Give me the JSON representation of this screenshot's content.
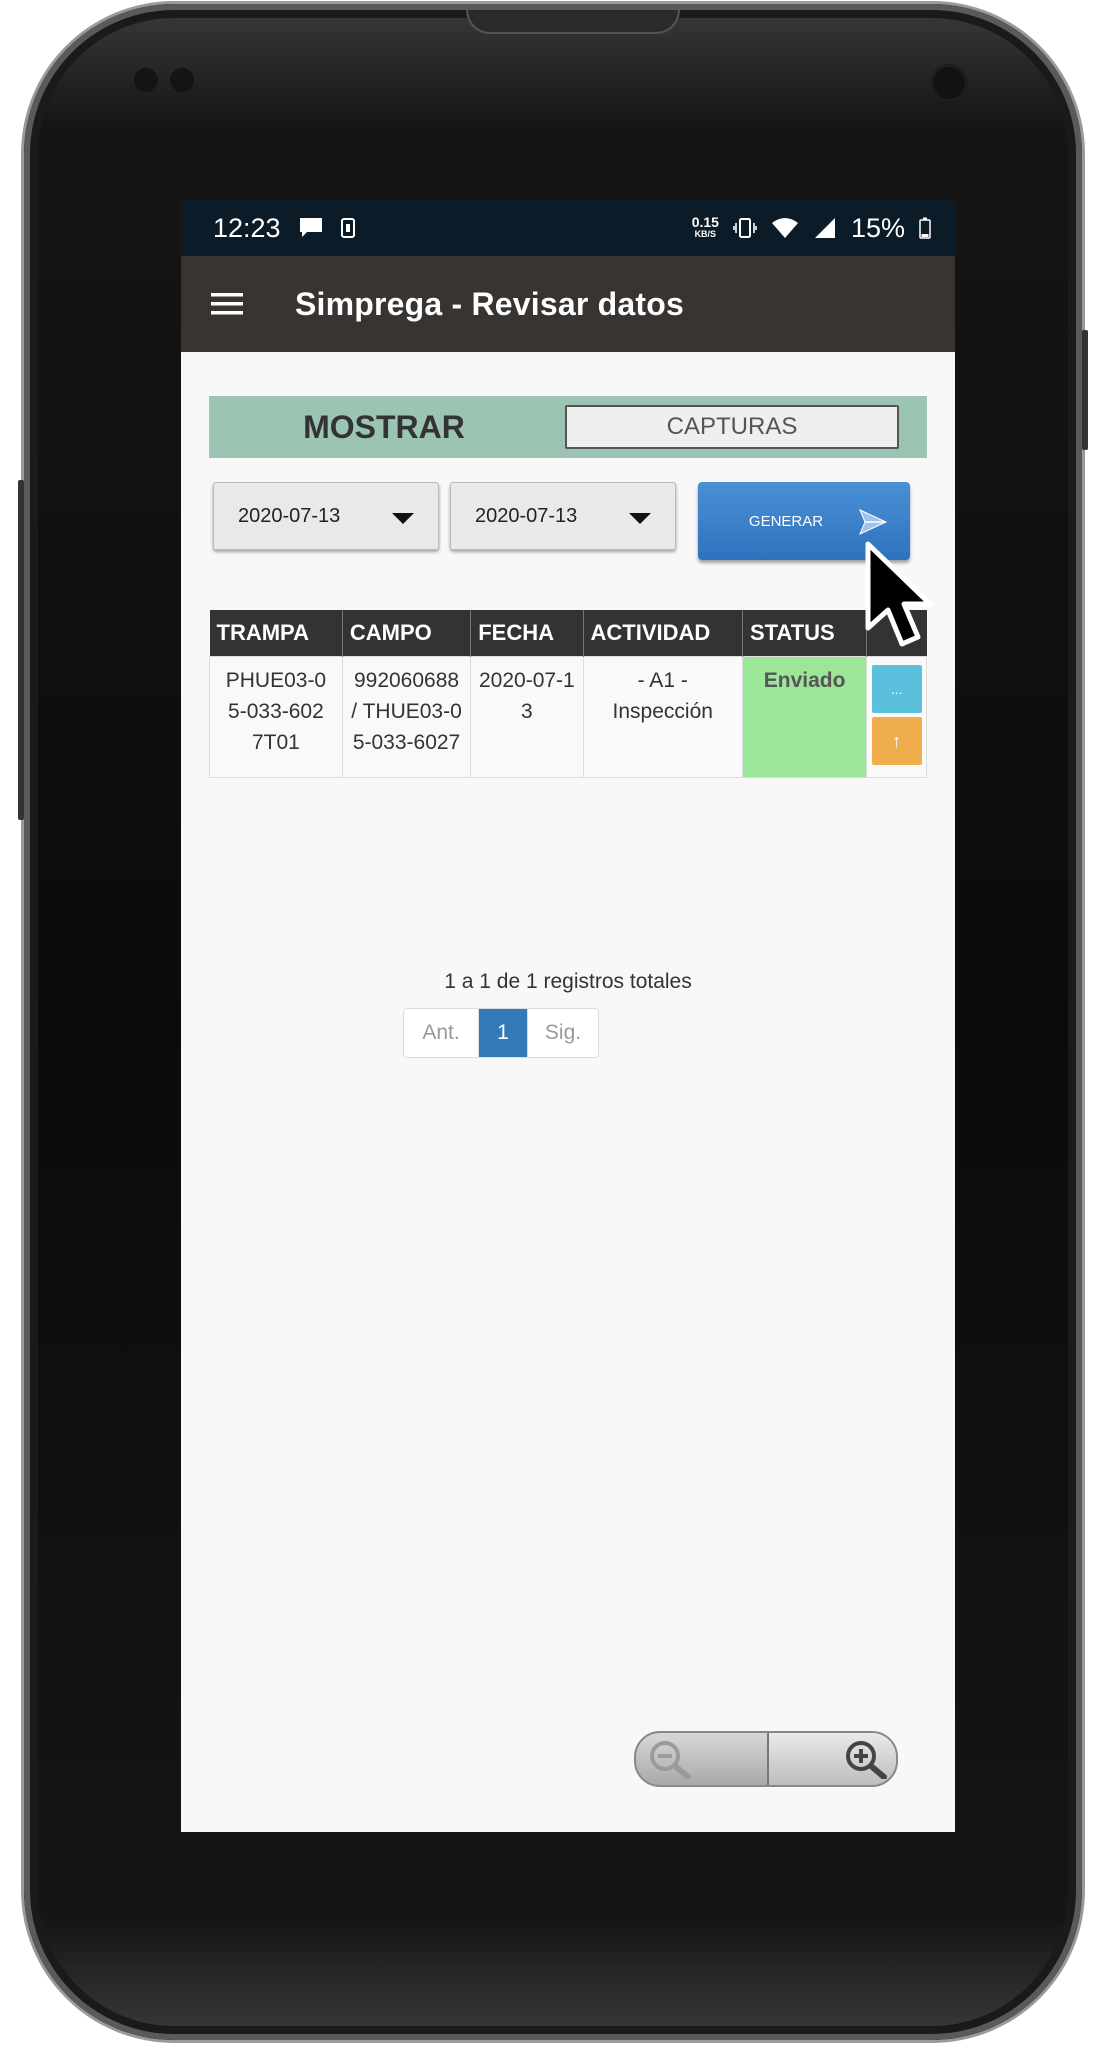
{
  "status_bar": {
    "time": "12:23",
    "net_speed_value": "0.15",
    "net_speed_unit": "KB/S",
    "battery": "15%"
  },
  "app_bar": {
    "title": "Simprega - Revisar datos"
  },
  "filter": {
    "mostrar_label": "MOSTRAR",
    "capturas_label": "CAPTURAS",
    "date_from": "2020-07-13",
    "date_to": "2020-07-13",
    "generate_label": "GENERAR"
  },
  "table": {
    "headers": [
      "TRAMPA",
      "CAMPO",
      "FECHA",
      "ACTIVIDAD",
      "STATUS"
    ],
    "rows": [
      {
        "trampa": "PHUE03-05-033-6027T01",
        "campo": "992060688 / THUE03-05-033-6027",
        "fecha": "2020-07-13",
        "actividad": "- A1 - Inspección",
        "status": "Enviado",
        "details_label": "...",
        "upload_label": "↑"
      }
    ]
  },
  "pagination": {
    "summary": "1 a 1 de 1 registros totales",
    "prev": "Ant.",
    "current": "1",
    "next": "Sig."
  },
  "colors": {
    "status_bar": "#0b1b28",
    "app_bar": "#383432",
    "filter_bar": "#9cc4b3",
    "generate_button": "#337ab7",
    "status_ok": "#9ce69a",
    "info_button": "#5bc0de",
    "upload_button": "#f0ad4e"
  }
}
